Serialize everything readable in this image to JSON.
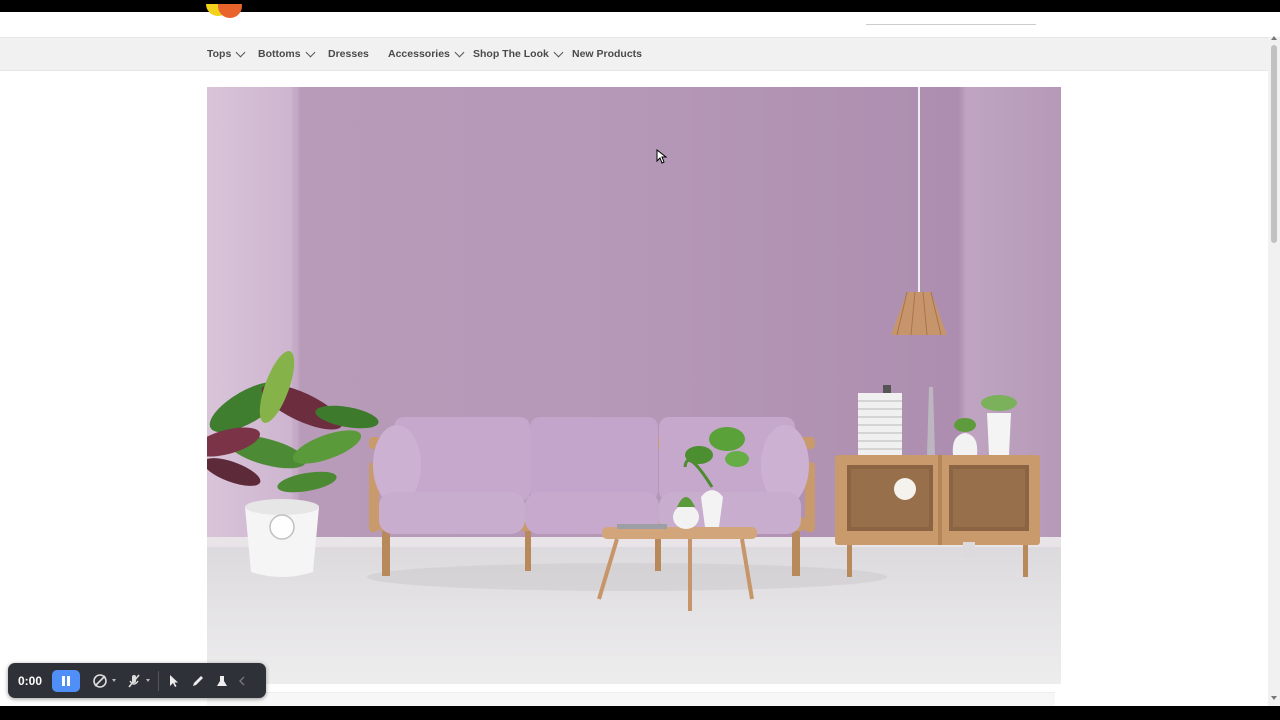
{
  "nav": {
    "items": [
      {
        "label": "Tops",
        "has_dropdown": true
      },
      {
        "label": "Bottoms",
        "has_dropdown": true
      },
      {
        "label": "Dresses",
        "has_dropdown": false
      },
      {
        "label": "Accessories",
        "has_dropdown": true
      },
      {
        "label": "Shop The Look",
        "has_dropdown": true
      },
      {
        "label": "New Products",
        "has_dropdown": false
      }
    ]
  },
  "hero": {
    "icon": "living-room-banner-image",
    "colors": {
      "wall": "#b597b7",
      "floor": "#e6e4e6",
      "sofa": "#c6a8cd",
      "wood": "#c89a6c"
    }
  },
  "recorder": {
    "time": "0:00",
    "icons": [
      "pause-icon",
      "camera-off-icon",
      "mic-off-icon",
      "pointer-icon",
      "pen-icon",
      "eraser-icon",
      "collapse-icon"
    ],
    "accent": "#4f8ff7"
  }
}
